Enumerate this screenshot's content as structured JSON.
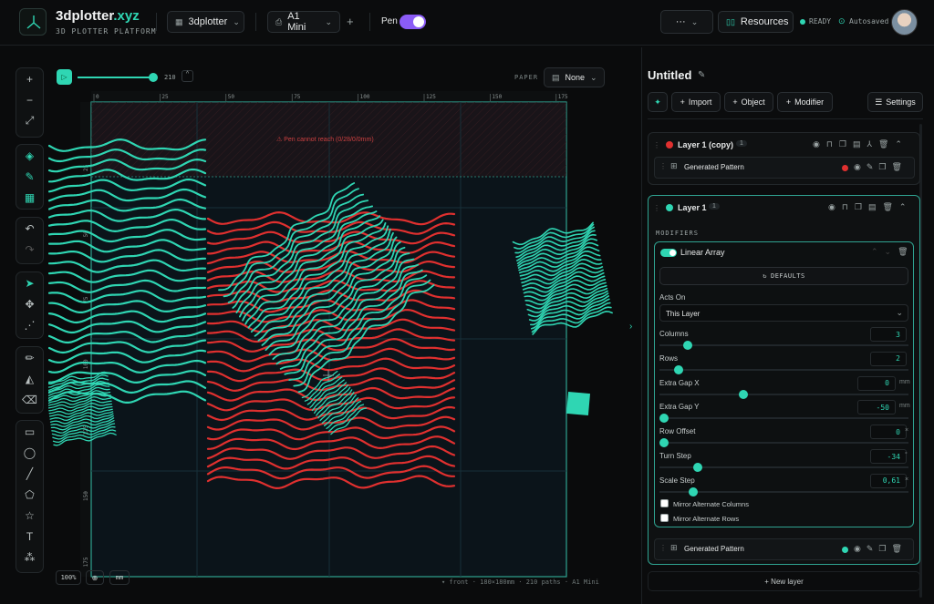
{
  "app": {
    "brand_main": "3dplotter",
    "brand_tld": ".xyz",
    "subtitle": "3D PLOTTER PLATFORM"
  },
  "topbar": {
    "workspace": "3dplotter",
    "machine": "A1 Mini",
    "pen_label": "Pen",
    "more": "···",
    "resources": "Resources",
    "status": "READY",
    "autosave": "Autosaved",
    "accent": "#2fd6b3",
    "pen_toggle_color": "#8b5cf6",
    "pen_on": true
  },
  "canvas_bar": {
    "range_value": "210",
    "paper_label": "PAPER",
    "paper_value": "None"
  },
  "ruler": {
    "top": [
      "0",
      "25",
      "50",
      "75",
      "100",
      "125",
      "150",
      "175"
    ],
    "left": [
      "25",
      "50",
      "75",
      "100",
      "125",
      "150",
      "175"
    ]
  },
  "canvas": {
    "warning": "⚠ Pen cannot reach (0/28/0/0mm)",
    "zoom": "100%",
    "unit": "mm",
    "status": "▾ front · 180×180mm · 210 paths · A1 Mini",
    "red_color": "#e0302f",
    "teal_color": "#2fd6b3"
  },
  "panel": {
    "title": "Untitled",
    "actions": {
      "import": "Import",
      "object": "Object",
      "modifier": "Modifier",
      "settings": "Settings"
    },
    "layers": [
      {
        "name": "Layer 1 (copy)",
        "count": "1",
        "color": "#e0302f",
        "child": "Generated Pattern"
      },
      {
        "name": "Layer 1",
        "count": "1",
        "color": "#2fd6b3",
        "child": "Generated Pattern"
      }
    ],
    "modifiers_label": "MODIFIERS",
    "modifier": {
      "name": "Linear Array",
      "defaults": "DEFAULTS",
      "acts_on_label": "Acts On",
      "acts_on_value": "This Layer",
      "params": [
        {
          "label": "Columns",
          "value": "3",
          "unit": "",
          "fraction": 0.1
        },
        {
          "label": "Rows",
          "value": "2",
          "unit": "",
          "fraction": 0.06
        },
        {
          "label": "Extra Gap X",
          "value": "0",
          "unit": "mm",
          "fraction": 0.33
        },
        {
          "label": "Extra Gap Y",
          "value": "-50",
          "unit": "mm",
          "fraction": 0.0
        },
        {
          "label": "Row Offset",
          "value": "0",
          "unit": "×",
          "fraction": 0.0
        },
        {
          "label": "Turn Step",
          "value": "-34",
          "unit": "°",
          "fraction": 0.14
        },
        {
          "label": "Scale Step",
          "value": "0,61",
          "unit": "×",
          "fraction": 0.12
        }
      ],
      "mirror_cols": "Mirror Alternate Columns",
      "mirror_rows": "Mirror Alternate Rows"
    },
    "new_layer": "+ New layer"
  }
}
